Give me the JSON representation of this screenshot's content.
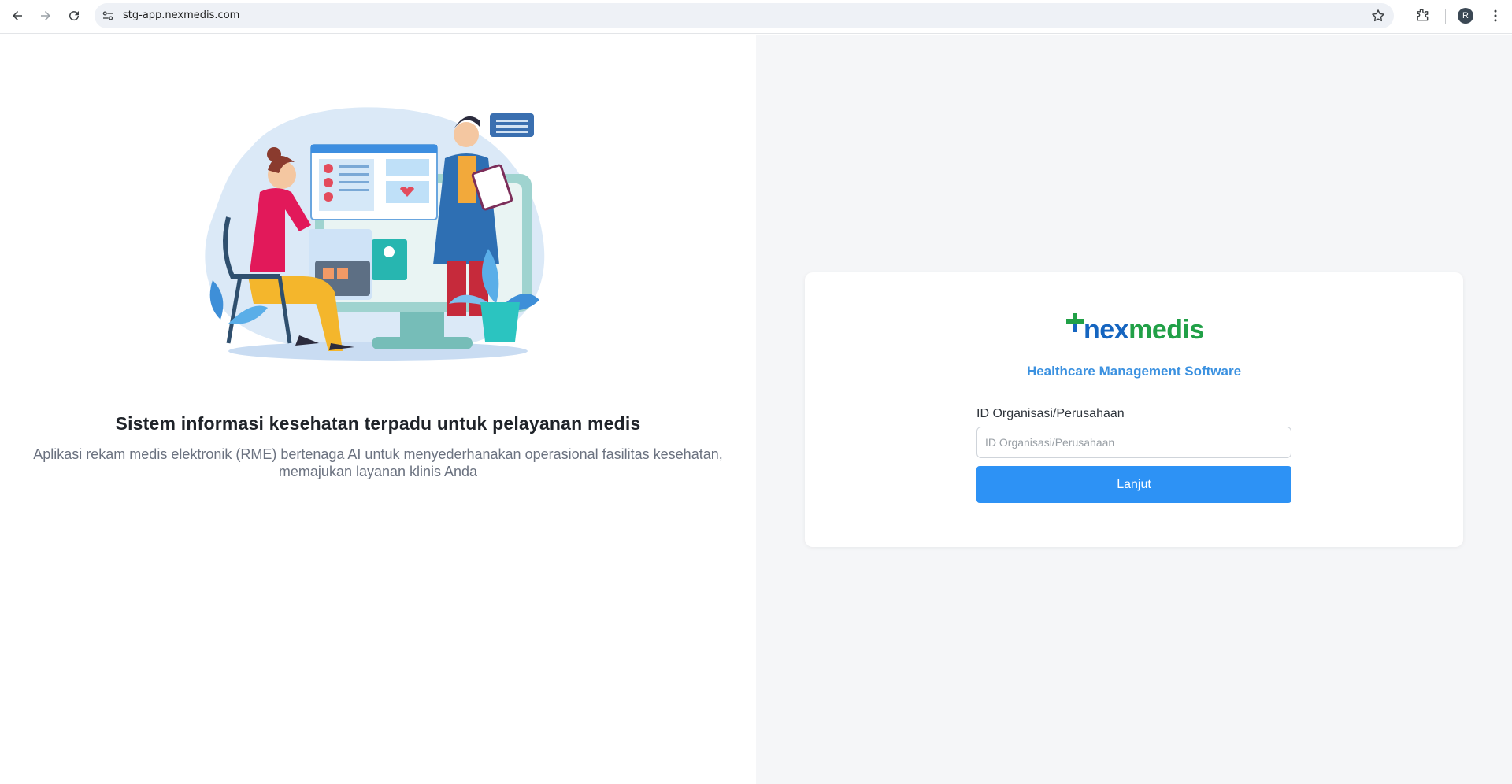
{
  "browser": {
    "url": "stg-app.nexmedis.com",
    "avatar_letter": "R"
  },
  "hero": {
    "title": "Sistem informasi kesehatan terpadu untuk pelayanan medis",
    "subtitle_line1": "Aplikasi rekam medis elektronik (RME) bertenaga AI untuk menyederhanakan operasional fasilitas kesehatan,",
    "subtitle_line2": "memajukan layanan klinis Anda"
  },
  "login": {
    "logo_nex": "nex",
    "logo_medis": "medis",
    "tagline": "Healthcare Management Software",
    "field_label": "ID Organisasi/Perusahaan",
    "field_placeholder": "ID Organisasi/Perusahaan",
    "field_value": "",
    "submit_label": "Lanjut"
  },
  "colors": {
    "brand_blue": "#1565c0",
    "brand_green": "#21a047",
    "accent": "#2d92f5",
    "tagline": "#3b91e0"
  },
  "icons": [
    "back-arrow-icon",
    "forward-arrow-icon",
    "reload-icon",
    "site-info-icon",
    "bookmark-star-icon",
    "extensions-icon",
    "more-menu-icon"
  ]
}
